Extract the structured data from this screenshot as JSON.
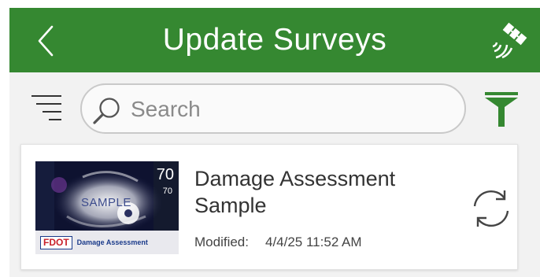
{
  "header": {
    "title": "Update Surveys",
    "back_icon": "chevron-left-icon",
    "location_icon": "satellite-gps-icon",
    "background_color": "#358831"
  },
  "toolbar": {
    "sort_icon": "sort-lines-icon",
    "search": {
      "placeholder": "Search",
      "value": ""
    },
    "filter_icon": "funnel-filter-icon",
    "accent_color": "#358831"
  },
  "surveys": [
    {
      "title": "Damage Assessment Sample",
      "modified_label": "Modified:",
      "modified_value": "4/4/25 11:52 AM",
      "thumbnail": {
        "watermark": "SAMPLE",
        "value_large": "70",
        "value_small": "70",
        "logo_text": "FDOT",
        "caption": "Damage Assessment"
      },
      "action_icon": "sync-icon"
    }
  ]
}
